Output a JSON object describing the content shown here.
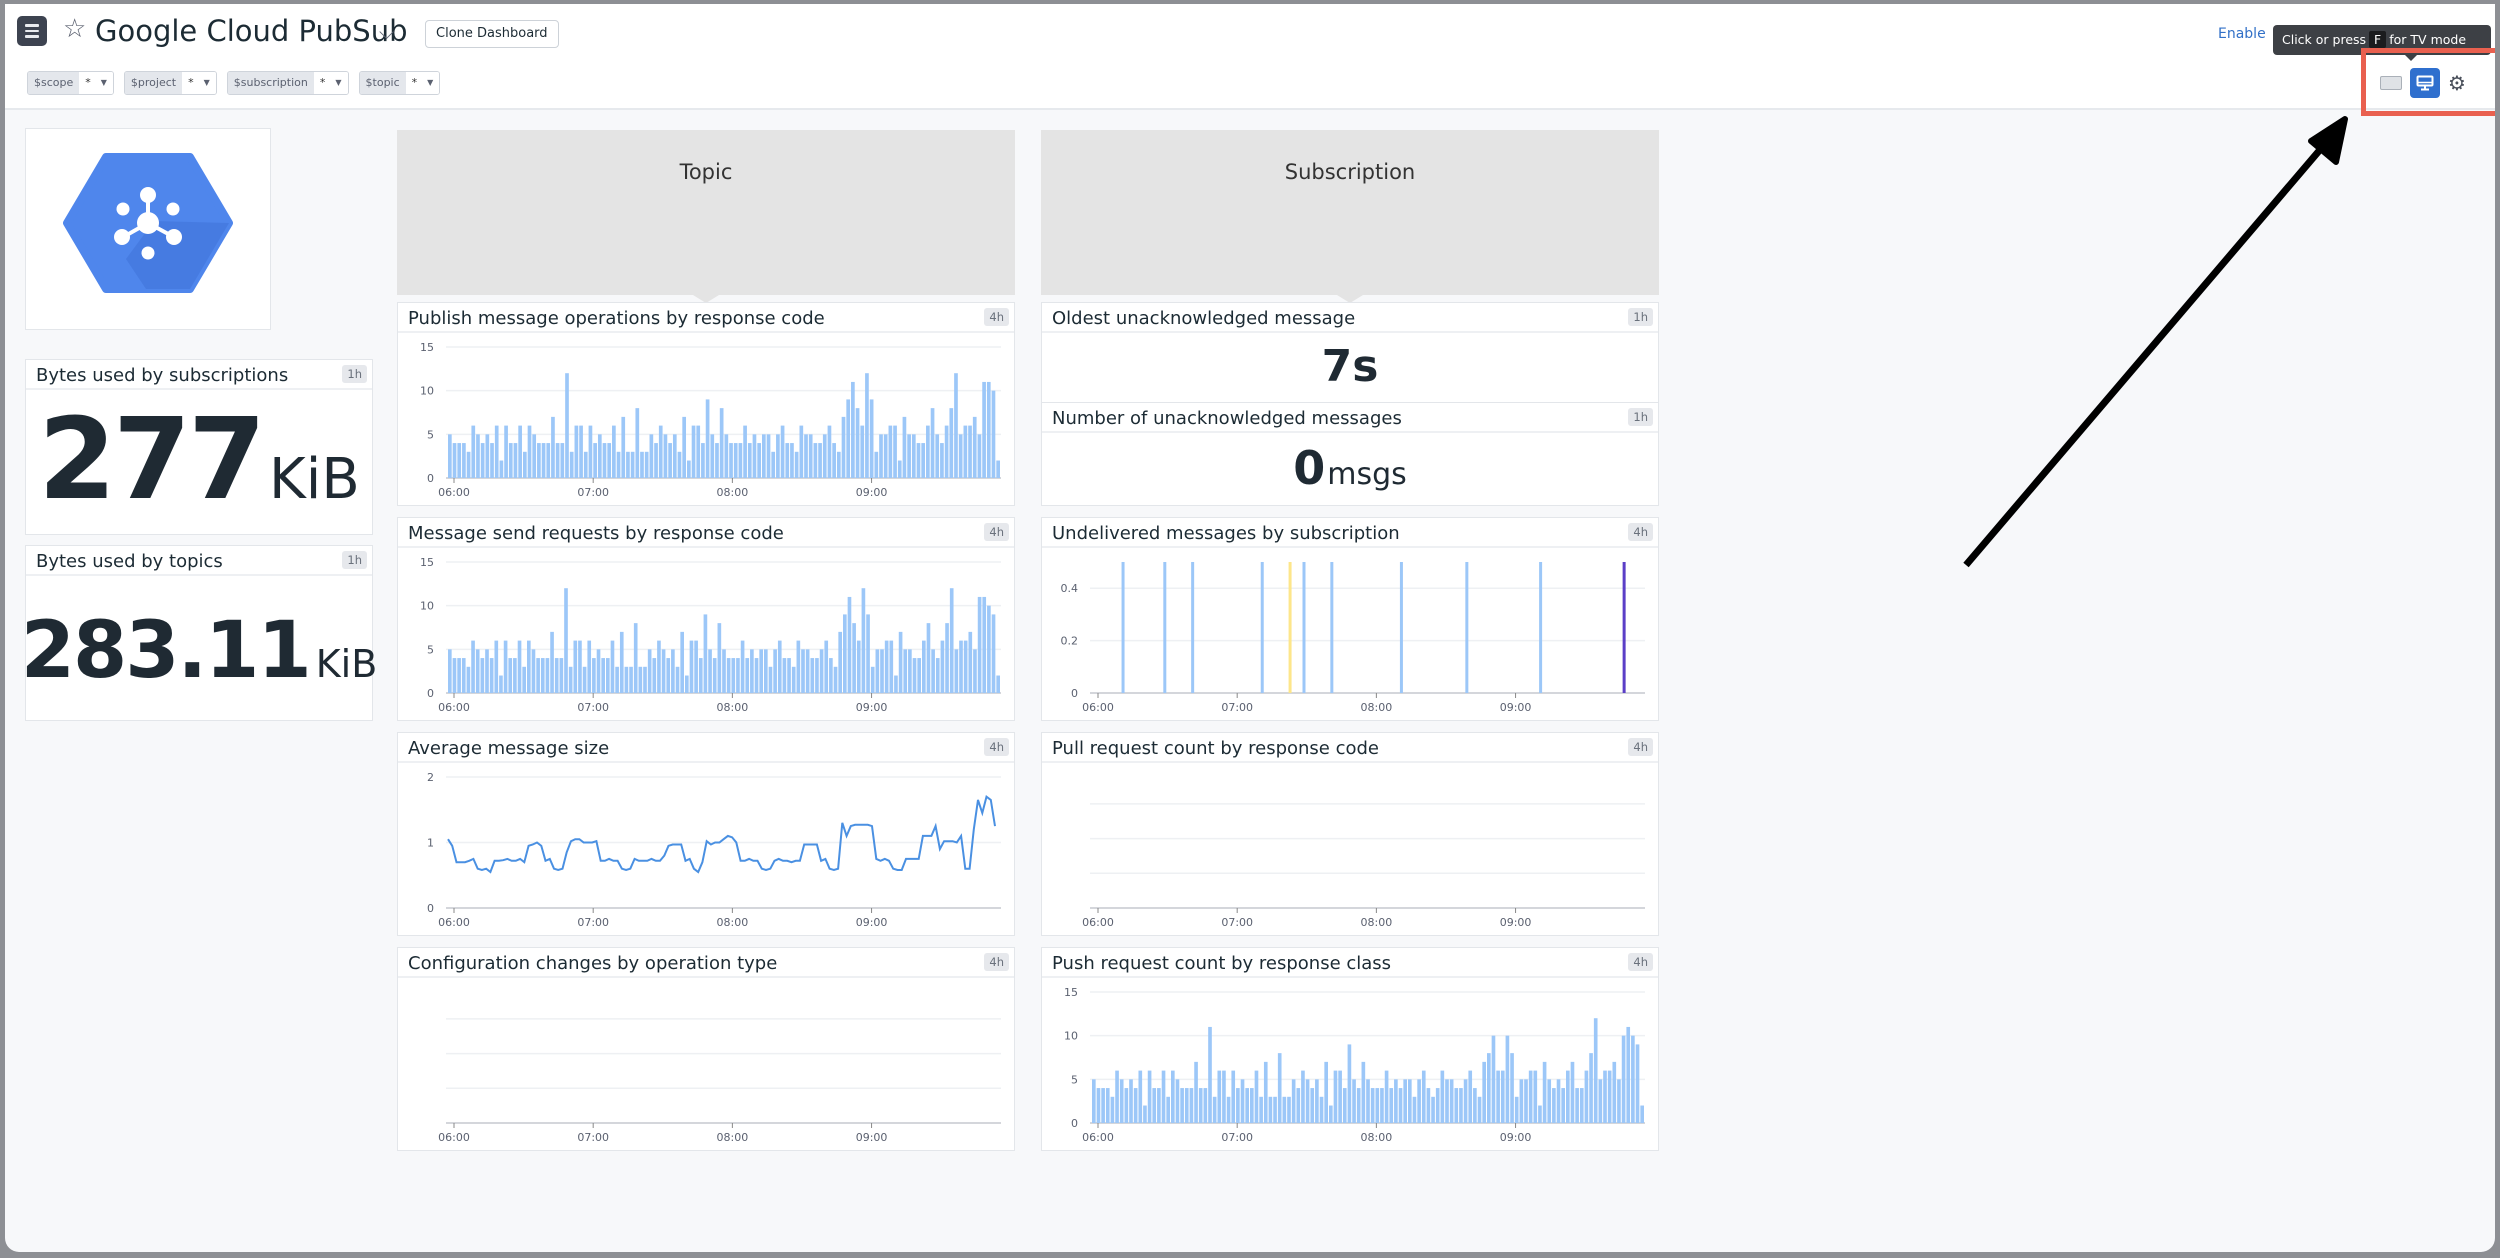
{
  "header": {
    "title": "Google Cloud PubSub",
    "clone_label": "Clone Dashboard",
    "enable_label": "Enable",
    "tooltip_prefix": "Click or press",
    "tooltip_key": "F",
    "tooltip_suffix": "for TV mode",
    "icons": [
      "hamburger-menu-icon",
      "star-icon",
      "chevron-down-icon",
      "keyboard-icon",
      "tv-mode-icon",
      "gear-icon"
    ],
    "highlight_color": "#e9604f",
    "tv_button_color": "#2f6fce"
  },
  "variables": [
    {
      "name": "$scope",
      "value": "*"
    },
    {
      "name": "$project",
      "value": "*"
    },
    {
      "name": "$subscription",
      "value": "*"
    },
    {
      "name": "$topic",
      "value": "*"
    }
  ],
  "groups": {
    "topic": "Topic",
    "subscription": "Subscription"
  },
  "query_values": {
    "bytes_subs": {
      "title": "Bytes used by subscriptions",
      "badge": "1h",
      "value": "277",
      "unit": "KiB"
    },
    "bytes_topics": {
      "title": "Bytes used by topics",
      "badge": "1h",
      "value": "283.11",
      "unit": "KiB"
    },
    "oldest_unacked": {
      "title": "Oldest unacknowledged message",
      "badge": "1h",
      "value": "7s",
      "unit": ""
    },
    "num_unacked": {
      "title": "Number of unacknowledged messages",
      "badge": "1h",
      "value": "0",
      "unit": "msgs"
    }
  },
  "chart_data": [
    {
      "id": "publish",
      "type": "bar",
      "title": "Publish message operations by response code",
      "badge": "4h",
      "x_ticks": [
        "06:00",
        "07:00",
        "08:00",
        "09:00"
      ],
      "y_ticks": [
        "0",
        "5",
        "10",
        "15"
      ],
      "ylim": [
        0,
        15
      ],
      "color": "#9cc7f8",
      "values": [
        5,
        4,
        4,
        4,
        3,
        6,
        5,
        4,
        5,
        4,
        6,
        2,
        6,
        4,
        4,
        6,
        3,
        6,
        5,
        4,
        4,
        4,
        7,
        4,
        4,
        12,
        3,
        6,
        6,
        3,
        6,
        4,
        5,
        4,
        4,
        6,
        3,
        7,
        3,
        3,
        8,
        3,
        3,
        5,
        4,
        6,
        5,
        4,
        5,
        3,
        7,
        2,
        6,
        6,
        4,
        9,
        5,
        4,
        8,
        5,
        4,
        4,
        4,
        6,
        4,
        5,
        4,
        5,
        5,
        3,
        5,
        6,
        4,
        4,
        3,
        6,
        5,
        5,
        4,
        4,
        5,
        6,
        4,
        3,
        7,
        9,
        11,
        8,
        6,
        12,
        9,
        3,
        5,
        5,
        6,
        6,
        2,
        7,
        5,
        5,
        4,
        4,
        6,
        8,
        5,
        4,
        6,
        8,
        12,
        5,
        6,
        6,
        7,
        5,
        11,
        11,
        10,
        2
      ]
    },
    {
      "id": "send",
      "type": "bar",
      "title": "Message send requests by response code",
      "badge": "4h",
      "x_ticks": [
        "06:00",
        "07:00",
        "08:00",
        "09:00"
      ],
      "y_ticks": [
        "0",
        "5",
        "10",
        "15"
      ],
      "ylim": [
        0,
        15
      ],
      "color": "#9cc7f8",
      "values": [
        5,
        4,
        4,
        4,
        3,
        6,
        5,
        4,
        5,
        4,
        6,
        2,
        6,
        4,
        4,
        6,
        3,
        6,
        5,
        4,
        4,
        4,
        7,
        4,
        4,
        12,
        3,
        6,
        6,
        3,
        6,
        4,
        5,
        4,
        4,
        6,
        3,
        7,
        3,
        3,
        8,
        3,
        3,
        5,
        4,
        6,
        5,
        4,
        5,
        3,
        7,
        2,
        6,
        6,
        4,
        9,
        5,
        4,
        8,
        5,
        4,
        4,
        4,
        6,
        4,
        5,
        4,
        5,
        5,
        3,
        5,
        6,
        4,
        4,
        3,
        6,
        5,
        5,
        4,
        4,
        5,
        6,
        4,
        3,
        7,
        9,
        11,
        8,
        6,
        12,
        9,
        3,
        5,
        5,
        6,
        6,
        2,
        7,
        5,
        5,
        4,
        4,
        6,
        8,
        5,
        4,
        6,
        8,
        12,
        5,
        6,
        6,
        7,
        5,
        11,
        11,
        10,
        9,
        2
      ]
    },
    {
      "id": "avgsize",
      "type": "line",
      "title": "Average message size",
      "badge": "4h",
      "x_ticks": [
        "06:00",
        "07:00",
        "08:00",
        "09:00"
      ],
      "y_ticks": [
        "0",
        "1",
        "2"
      ],
      "ylim": [
        0,
        2
      ],
      "color": "#4a90e2",
      "values": [
        1.05,
        0.95,
        0.7,
        0.7,
        0.7,
        0.72,
        0.75,
        0.6,
        0.58,
        0.6,
        0.55,
        0.72,
        0.72,
        0.73,
        0.75,
        0.72,
        0.72,
        0.75,
        0.7,
        0.95,
        0.97,
        1.0,
        0.95,
        0.72,
        0.75,
        0.6,
        0.58,
        0.6,
        0.85,
        1.02,
        1.05,
        1.05,
        1.0,
        1.0,
        1.0,
        1.02,
        0.72,
        0.72,
        0.75,
        0.72,
        0.72,
        0.6,
        0.58,
        0.6,
        0.75,
        0.72,
        0.72,
        0.72,
        0.75,
        0.72,
        0.72,
        0.8,
        0.95,
        0.97,
        0.97,
        0.97,
        0.72,
        0.75,
        0.6,
        0.55,
        0.7,
        1.02,
        0.97,
        1.0,
        1.0,
        1.05,
        1.1,
        1.08,
        1.0,
        0.72,
        0.72,
        0.75,
        0.72,
        0.72,
        0.6,
        0.58,
        0.6,
        0.72,
        0.75,
        0.72,
        0.72,
        0.7,
        0.72,
        0.72,
        0.97,
        0.97,
        0.97,
        0.97,
        0.72,
        0.75,
        0.6,
        0.58,
        0.6,
        1.3,
        1.1,
        1.25,
        1.27,
        1.27,
        1.27,
        1.27,
        1.25,
        0.75,
        0.72,
        0.75,
        0.72,
        0.6,
        0.58,
        0.58,
        0.75,
        0.75,
        0.75,
        0.75,
        1.1,
        1.1,
        1.1,
        1.25,
        0.9,
        1.02,
        1.02,
        1.02,
        1.0,
        1.1,
        0.6,
        0.6,
        1.2,
        1.65,
        1.45,
        1.7,
        1.65,
        1.25
      ]
    },
    {
      "id": "config",
      "type": "line",
      "title": "Configuration changes by operation type",
      "badge": "4h",
      "x_ticks": [
        "06:00",
        "07:00",
        "08:00",
        "09:00"
      ],
      "y_ticks": [],
      "values": []
    },
    {
      "id": "undelivered",
      "type": "bar",
      "title": "Undelivered messages by subscription",
      "badge": "4h",
      "x_ticks": [
        "06:00",
        "07:00",
        "08:00",
        "09:00"
      ],
      "y_ticks": [
        "0",
        "0.2",
        "0.4"
      ],
      "ylim": [
        0,
        0.5
      ],
      "spikes": [
        {
          "t": 0.18,
          "value": 0.5,
          "color": "#9cc7f8"
        },
        {
          "t": 0.48,
          "value": 0.5,
          "color": "#9cc7f8"
        },
        {
          "t": 0.68,
          "value": 0.5,
          "color": "#9cc7f8"
        },
        {
          "t": 1.18,
          "value": 0.5,
          "color": "#9cc7f8"
        },
        {
          "t": 1.38,
          "value": 0.5,
          "color": "#fde68a"
        },
        {
          "t": 1.48,
          "value": 0.5,
          "color": "#9cc7f8"
        },
        {
          "t": 1.68,
          "value": 0.5,
          "color": "#9cc7f8"
        },
        {
          "t": 2.18,
          "value": 0.5,
          "color": "#9cc7f8"
        },
        {
          "t": 2.65,
          "value": 0.5,
          "color": "#9cc7f8"
        },
        {
          "t": 3.18,
          "value": 0.5,
          "color": "#9cc7f8"
        },
        {
          "t": 3.78,
          "value": 0.5,
          "color": "#5b3fc7"
        }
      ]
    },
    {
      "id": "pull",
      "type": "line",
      "title": "Pull request count by response code",
      "badge": "4h",
      "x_ticks": [
        "06:00",
        "07:00",
        "08:00",
        "09:00"
      ],
      "y_ticks": [],
      "values": []
    },
    {
      "id": "push",
      "type": "bar",
      "title": "Push request count by response class",
      "badge": "4h",
      "x_ticks": [
        "06:00",
        "07:00",
        "08:00",
        "09:00"
      ],
      "y_ticks": [
        "0",
        "5",
        "10",
        "15"
      ],
      "ylim": [
        0,
        15
      ],
      "color": "#9cc7f8",
      "values": [
        5,
        4,
        4,
        4,
        3,
        6,
        5,
        4,
        5,
        4,
        6,
        2,
        6,
        4,
        4,
        6,
        3,
        6,
        5,
        4,
        4,
        4,
        7,
        4,
        4,
        11,
        3,
        6,
        6,
        3,
        6,
        4,
        5,
        4,
        4,
        6,
        3,
        7,
        3,
        3,
        8,
        3,
        3,
        5,
        4,
        6,
        5,
        4,
        5,
        3,
        7,
        2,
        6,
        6,
        4,
        9,
        5,
        4,
        7,
        5,
        4,
        4,
        4,
        6,
        4,
        5,
        4,
        5,
        5,
        3,
        5,
        6,
        4,
        3,
        4,
        6,
        5,
        5,
        4,
        4,
        5,
        6,
        4,
        3,
        7,
        8,
        10,
        6,
        6,
        10,
        8,
        3,
        5,
        5,
        6,
        6,
        2,
        7,
        5,
        4,
        5,
        4,
        6,
        7,
        4,
        4,
        6,
        8,
        12,
        5,
        6,
        6,
        7,
        5,
        10,
        11,
        10,
        9,
        2
      ]
    }
  ]
}
